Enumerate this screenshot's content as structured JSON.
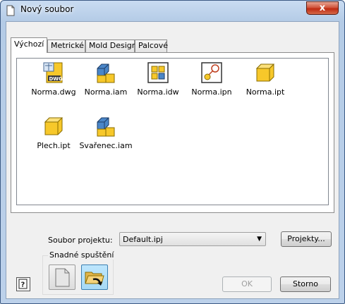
{
  "window": {
    "title": "Nový soubor",
    "close_glyph": "x"
  },
  "tabs": [
    {
      "label": "Výchozí",
      "active": true
    },
    {
      "label": "Metrické",
      "active": false
    },
    {
      "label": "Mold Design",
      "active": false
    },
    {
      "label": "Palcové",
      "active": false
    }
  ],
  "files": [
    {
      "label": "Norma.dwg",
      "icon": "dwg-drawing-icon"
    },
    {
      "label": "Norma.iam",
      "icon": "assembly-icon"
    },
    {
      "label": "Norma.idw",
      "icon": "drawing-icon"
    },
    {
      "label": "Norma.ipn",
      "icon": "presentation-icon"
    },
    {
      "label": "Norma.ipt",
      "icon": "part-icon"
    },
    {
      "label": "Plech.ipt",
      "icon": "sheet-metal-part-icon"
    },
    {
      "label": "Svařenec.iam",
      "icon": "weldment-icon"
    }
  ],
  "project": {
    "label": "Soubor projektu:",
    "value": "Default.ipj",
    "button": "Projekty..."
  },
  "quick_launch": {
    "label": "Snadné spuštění"
  },
  "buttons": {
    "ok": "OK",
    "cancel": "Storno"
  },
  "colors": {
    "part_yellow": "#f7c82a",
    "assembly_blue": "#4a86c8",
    "close_red": "#c7381b"
  }
}
